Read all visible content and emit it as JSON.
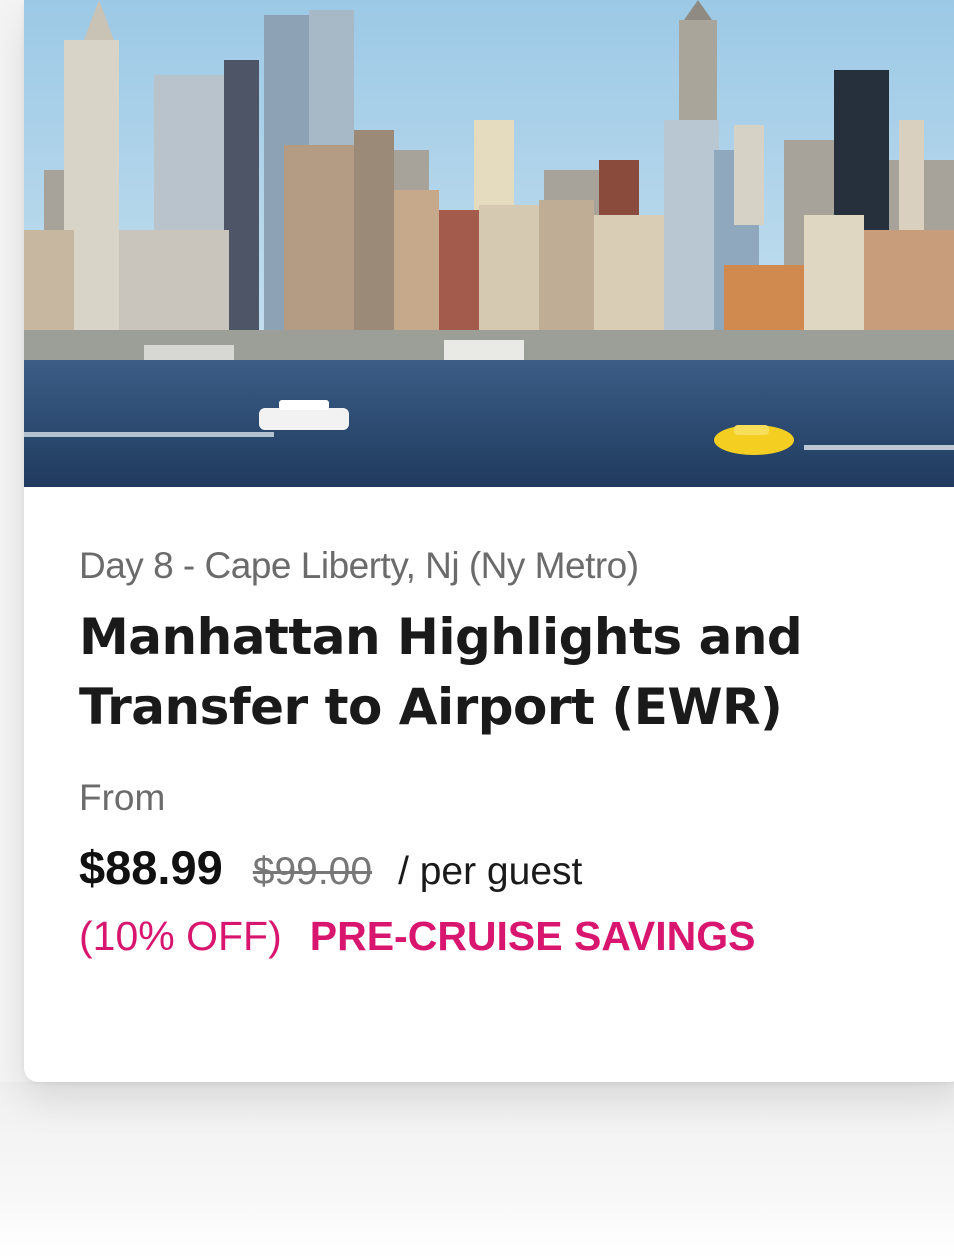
{
  "card": {
    "image_alt": "Manhattan skyline across the river",
    "day_label": "Day 8 - Cape Liberty, Nj (Ny Metro)",
    "title": "Manhattan Highlights and Transfer to Airport (EWR)",
    "from_label": "From",
    "price_current": "$88.99",
    "price_original": "$99.00",
    "price_unit": "/ per guest",
    "discount": "(10% OFF)",
    "savings_label": "PRE-CRUISE SAVINGS"
  },
  "colors": {
    "accent": "#d9166f",
    "title": "#1a1a1a",
    "muted": "#6b6b6b"
  }
}
